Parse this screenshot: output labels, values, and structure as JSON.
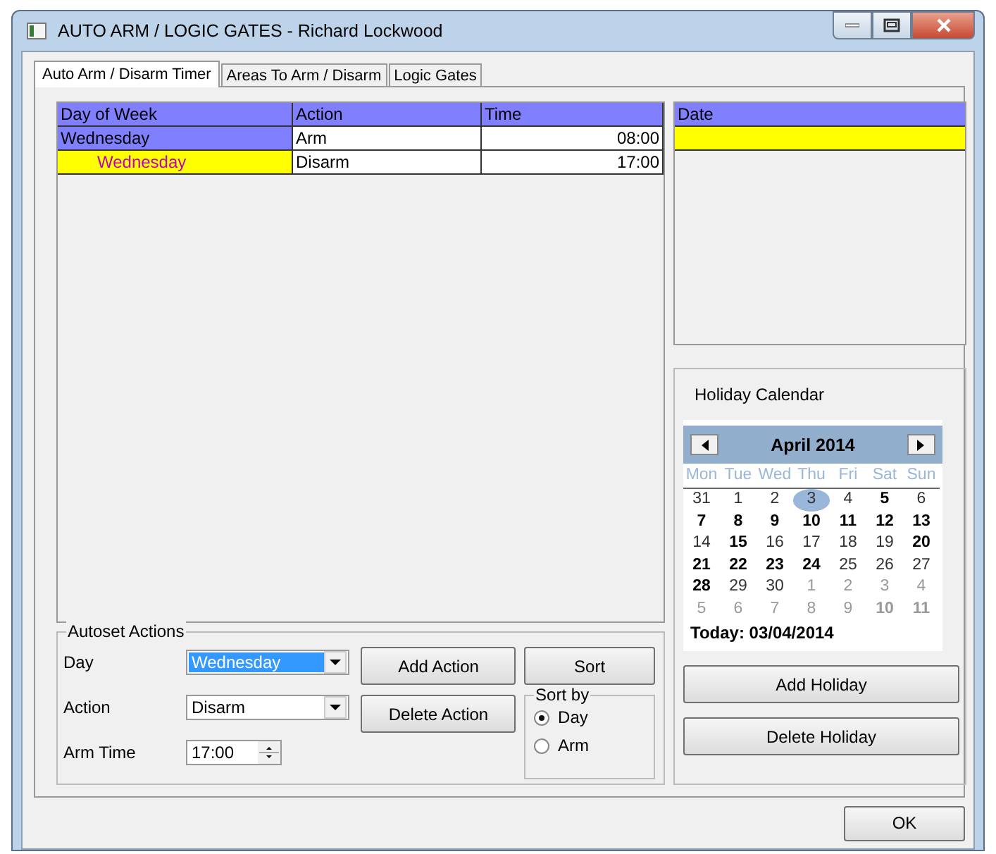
{
  "window": {
    "title": "AUTO ARM / LOGIC GATES - Richard Lockwood"
  },
  "tabs": [
    {
      "label": "Auto Arm / Disarm Timer",
      "selected": true
    },
    {
      "label": "Areas To Arm / Disarm",
      "selected": false
    },
    {
      "label": "Logic Gates",
      "selected": false
    }
  ],
  "schedule": {
    "columns": [
      "Day of Week",
      "Action",
      "Time"
    ],
    "rows": [
      {
        "day": "Wednesday",
        "action": "Arm",
        "time": "08:00",
        "selected": false
      },
      {
        "day": "Wednesday",
        "action": "Disarm",
        "time": "17:00",
        "selected": true
      }
    ]
  },
  "dates": {
    "column": "Date",
    "rows": [
      {
        "selected": true
      }
    ]
  },
  "autoset": {
    "title": "Autoset Actions",
    "fields": [
      {
        "label": "Day",
        "value": "Wednesday",
        "kind": "dropdown",
        "highlighted": true
      },
      {
        "label": "Action",
        "value": "Disarm",
        "kind": "dropdown",
        "highlighted": false
      },
      {
        "label": "Arm Time",
        "value": "17:00",
        "kind": "spinner"
      }
    ],
    "buttons": [
      "Add Action",
      "Delete Action"
    ],
    "sort_button": "Sort",
    "sort_by": {
      "title": "Sort by",
      "options": [
        {
          "label": "Day",
          "selected": true
        },
        {
          "label": "Arm",
          "selected": false
        }
      ]
    }
  },
  "holiday_calendar": {
    "title": "Holiday Calendar",
    "month": "April 2014",
    "weekdays": [
      "Mon",
      "Tue",
      "Wed",
      "Thu",
      "Fri",
      "Sat",
      "Sun"
    ],
    "weeks": [
      [
        {
          "d": "31",
          "bold": false,
          "dim": false,
          "selected": false
        },
        {
          "d": "1",
          "bold": false,
          "dim": false,
          "selected": false
        },
        {
          "d": "2",
          "bold": false,
          "dim": false,
          "selected": false
        },
        {
          "d": "3",
          "bold": false,
          "dim": false,
          "selected": true
        },
        {
          "d": "4",
          "bold": false,
          "dim": false,
          "selected": false
        },
        {
          "d": "5",
          "bold": true,
          "dim": false,
          "selected": false
        },
        {
          "d": "6",
          "bold": false,
          "dim": false,
          "selected": false
        }
      ],
      [
        {
          "d": "7",
          "bold": true,
          "dim": false,
          "selected": false
        },
        {
          "d": "8",
          "bold": true,
          "dim": false,
          "selected": false
        },
        {
          "d": "9",
          "bold": true,
          "dim": false,
          "selected": false
        },
        {
          "d": "10",
          "bold": true,
          "dim": false,
          "selected": false
        },
        {
          "d": "11",
          "bold": true,
          "dim": false,
          "selected": false
        },
        {
          "d": "12",
          "bold": true,
          "dim": false,
          "selected": false
        },
        {
          "d": "13",
          "bold": true,
          "dim": false,
          "selected": false
        }
      ],
      [
        {
          "d": "14",
          "bold": false,
          "dim": false,
          "selected": false
        },
        {
          "d": "15",
          "bold": true,
          "dim": false,
          "selected": false
        },
        {
          "d": "16",
          "bold": false,
          "dim": false,
          "selected": false
        },
        {
          "d": "17",
          "bold": false,
          "dim": false,
          "selected": false
        },
        {
          "d": "18",
          "bold": false,
          "dim": false,
          "selected": false
        },
        {
          "d": "19",
          "bold": false,
          "dim": false,
          "selected": false
        },
        {
          "d": "20",
          "bold": true,
          "dim": false,
          "selected": false
        }
      ],
      [
        {
          "d": "21",
          "bold": true,
          "dim": false,
          "selected": false
        },
        {
          "d": "22",
          "bold": true,
          "dim": false,
          "selected": false
        },
        {
          "d": "23",
          "bold": true,
          "dim": false,
          "selected": false
        },
        {
          "d": "24",
          "bold": true,
          "dim": false,
          "selected": false
        },
        {
          "d": "25",
          "bold": false,
          "dim": false,
          "selected": false
        },
        {
          "d": "26",
          "bold": false,
          "dim": false,
          "selected": false
        },
        {
          "d": "27",
          "bold": false,
          "dim": false,
          "selected": false
        }
      ],
      [
        {
          "d": "28",
          "bold": true,
          "dim": false,
          "selected": false
        },
        {
          "d": "29",
          "bold": false,
          "dim": false,
          "selected": false
        },
        {
          "d": "30",
          "bold": false,
          "dim": false,
          "selected": false
        },
        {
          "d": "1",
          "bold": false,
          "dim": true,
          "selected": false
        },
        {
          "d": "2",
          "bold": false,
          "dim": true,
          "selected": false
        },
        {
          "d": "3",
          "bold": false,
          "dim": true,
          "selected": false
        },
        {
          "d": "4",
          "bold": false,
          "dim": true,
          "selected": false
        }
      ],
      [
        {
          "d": "5",
          "bold": false,
          "dim": true,
          "selected": false
        },
        {
          "d": "6",
          "bold": false,
          "dim": true,
          "selected": false
        },
        {
          "d": "7",
          "bold": false,
          "dim": true,
          "selected": false
        },
        {
          "d": "8",
          "bold": false,
          "dim": true,
          "selected": false
        },
        {
          "d": "9",
          "bold": false,
          "dim": true,
          "selected": false
        },
        {
          "d": "10",
          "bold": true,
          "dim": true,
          "selected": false
        },
        {
          "d": "11",
          "bold": true,
          "dim": true,
          "selected": false
        }
      ]
    ],
    "today": "Today: 03/04/2014"
  },
  "holiday_buttons": [
    "Add Holiday",
    "Delete Holiday"
  ],
  "ok_button": "OK"
}
